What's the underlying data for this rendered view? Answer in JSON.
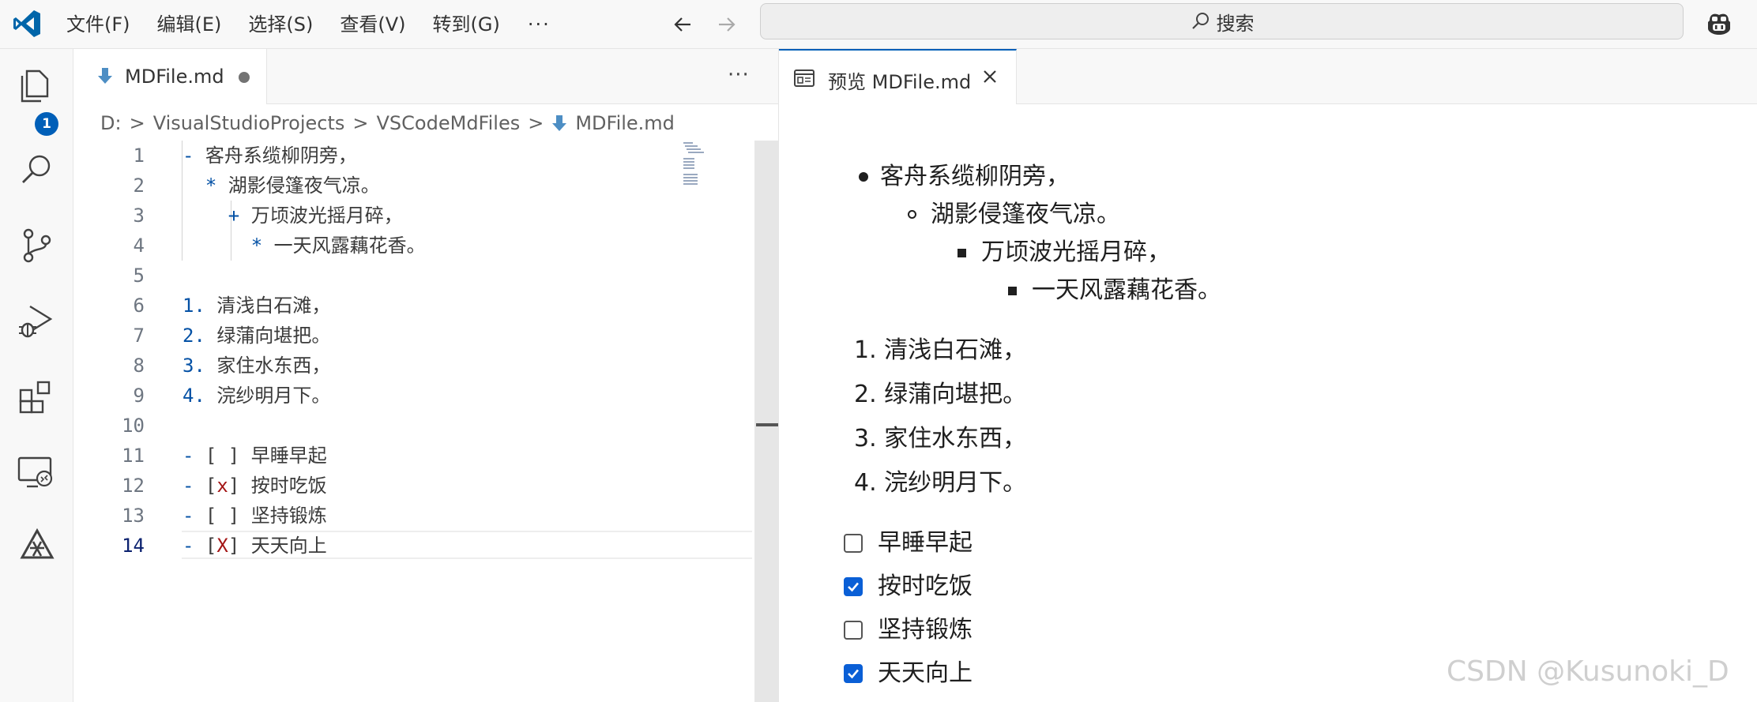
{
  "titlebar": {
    "menu": [
      "文件(F)",
      "编辑(E)",
      "选择(S)",
      "查看(V)",
      "转到(G)"
    ],
    "more": "···",
    "search_label": "搜索"
  },
  "activity_bar": {
    "items": [
      "explorer-icon",
      "search-icon",
      "source-control-icon",
      "run-debug-icon",
      "extensions-icon",
      "remote-explorer-icon",
      "copilot-chat-icon"
    ],
    "explorer_badge": "1"
  },
  "editor": {
    "tab_name": "MDFile.md",
    "more": "···",
    "breadcrumb": [
      "D:",
      "VisualStudioProjects",
      "VSCodeMdFiles",
      "MDFile.md"
    ],
    "lines": [
      {
        "n": "1",
        "text": "- 客舟系缆柳阴旁，"
      },
      {
        "n": "2",
        "text": "  * 湖影侵篷夜气凉。"
      },
      {
        "n": "3",
        "text": "    + 万顷波光摇月碎，"
      },
      {
        "n": "4",
        "text": "      * 一天风露藕花香。"
      },
      {
        "n": "5",
        "text": ""
      },
      {
        "n": "6",
        "text": "1. 清浅白石滩，"
      },
      {
        "n": "7",
        "text": "2. 绿蒲向堪把。"
      },
      {
        "n": "8",
        "text": "3. 家住水东西，"
      },
      {
        "n": "9",
        "text": "4. 浣纱明月下。"
      },
      {
        "n": "10",
        "text": ""
      },
      {
        "n": "11",
        "text": "- [ ] 早睡早起"
      },
      {
        "n": "12",
        "text": "- [x] 按时吃饭"
      },
      {
        "n": "13",
        "text": "- [ ] 坚持锻炼"
      },
      {
        "n": "14",
        "text": "- [X] 天天向上"
      }
    ]
  },
  "preview": {
    "tab_name": "预览 MDFile.md",
    "nested_list": [
      "客舟系缆柳阴旁，",
      "湖影侵篷夜气凉。",
      "万顷波光摇月碎，",
      "一天风露藕花香。"
    ],
    "ordered_list": [
      "1. 清浅白石滩，",
      "2. 绿蒲向堪把。",
      "3. 家住水东西，",
      "4. 浣纱明月下。"
    ],
    "tasks": [
      {
        "label": "早睡早起",
        "checked": false
      },
      {
        "label": "按时吃饭",
        "checked": true
      },
      {
        "label": "坚持锻炼",
        "checked": false
      },
      {
        "label": "天天向上",
        "checked": true
      }
    ]
  },
  "watermark": "CSDN @Kusunoki_D",
  "colors": {
    "accent": "#005fb8",
    "checkbox": "#0a5fd6",
    "list_marker": "#0451a5",
    "task_x": "#a31515"
  }
}
